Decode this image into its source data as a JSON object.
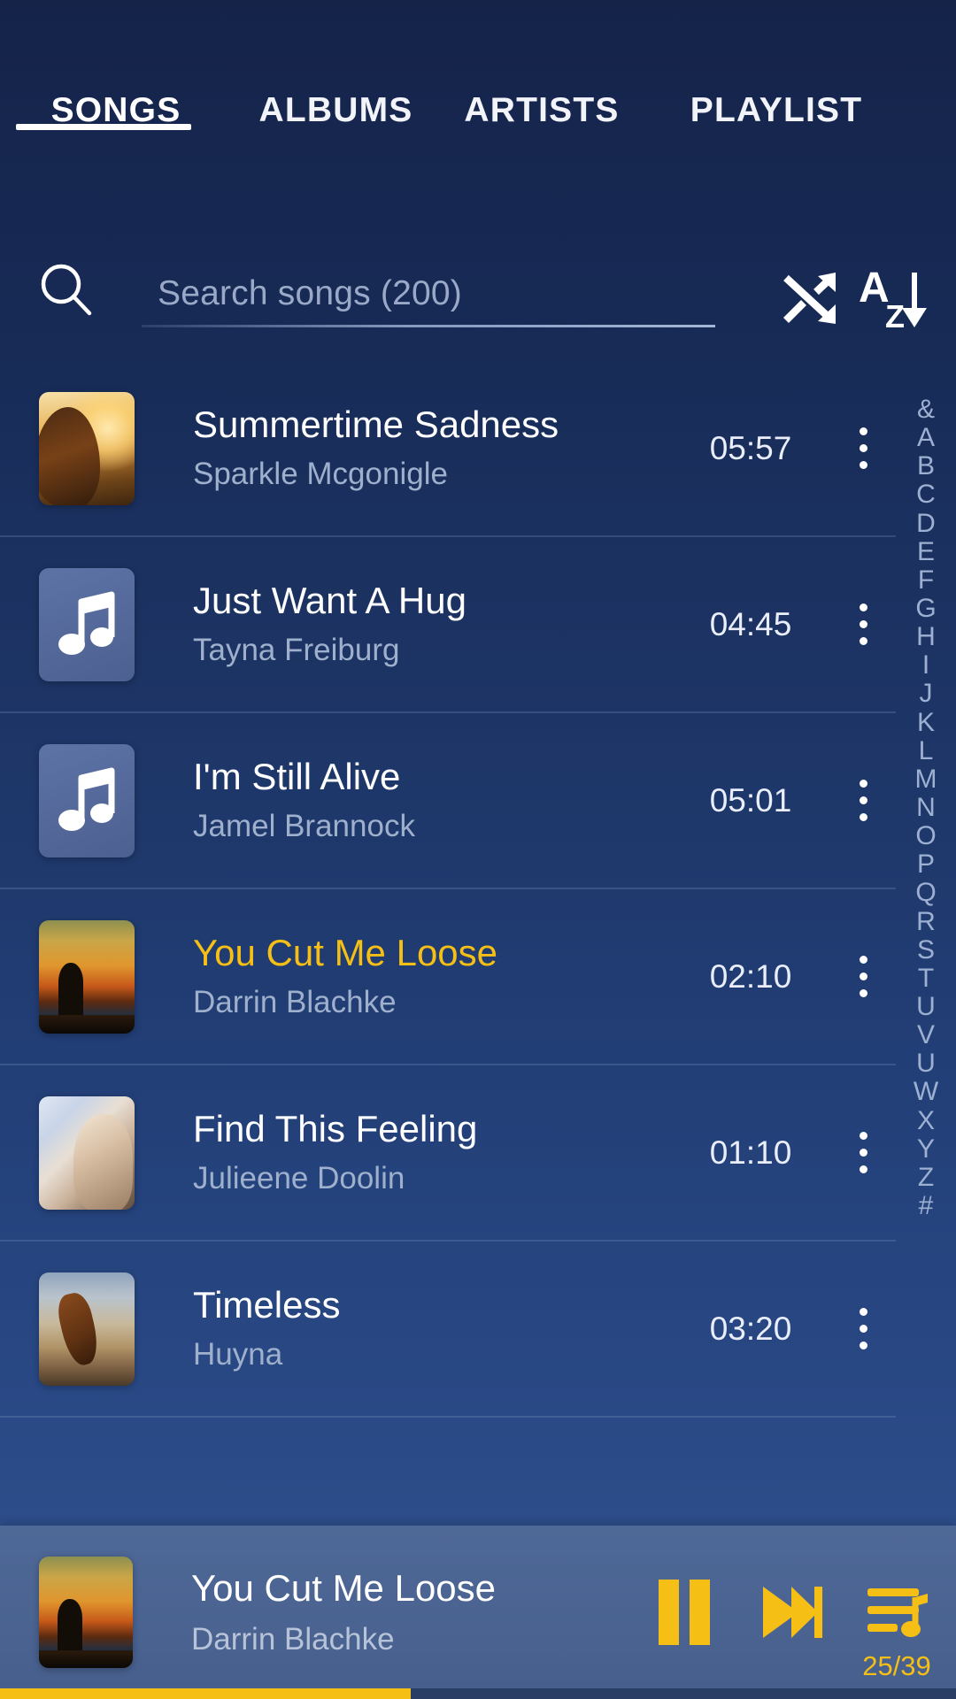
{
  "theme": {
    "bg_top": "#152349",
    "bg_bottom": "#33548f",
    "accent": "#f5bf15",
    "text_primary": "#ffffff",
    "text_secondary": "#9fb0cd",
    "nowbar_bg": "#4a6391"
  },
  "tabs": [
    {
      "label": "SONGS",
      "active": true
    },
    {
      "label": "ALBUMS",
      "active": false
    },
    {
      "label": "ARTISTS",
      "active": false
    },
    {
      "label": "PLAYLIST",
      "active": false
    }
  ],
  "search": {
    "placeholder": "Search songs (200)",
    "value": "",
    "icon": "search-icon",
    "shuffle_icon": "shuffle-icon",
    "sort_icon": "sort-alpha-ascending-icon",
    "sort_letter_top": "A",
    "sort_letter_bottom": "Z"
  },
  "songs": [
    {
      "title": "Summertime Sadness",
      "artist": "Sparkle Mcgonigle",
      "duration": "05:57",
      "art": "photo1",
      "playing": false
    },
    {
      "title": "Just Want A Hug",
      "artist": "Tayna Freiburg",
      "duration": "04:45",
      "art": "placeholder",
      "playing": false
    },
    {
      "title": "I'm Still Alive",
      "artist": "Jamel Brannock",
      "duration": "05:01",
      "art": "placeholder",
      "playing": false
    },
    {
      "title": "You Cut Me Loose",
      "artist": "Darrin Blachke",
      "duration": "02:10",
      "art": "photo2",
      "playing": true
    },
    {
      "title": "Find This Feeling",
      "artist": "Julieene Doolin",
      "duration": "01:10",
      "art": "photo3",
      "playing": false
    },
    {
      "title": "Timeless",
      "artist": "Huyna",
      "duration": "03:20",
      "art": "photo4",
      "playing": false
    }
  ],
  "alphabet_index": [
    "&",
    "A",
    "B",
    "C",
    "D",
    "E",
    "F",
    "G",
    "H",
    "I",
    "J",
    "K",
    "L",
    "M",
    "N",
    "O",
    "P",
    "Q",
    "R",
    "S",
    "T",
    "U",
    "V",
    "U",
    "W",
    "X",
    "Y",
    "Z",
    "#"
  ],
  "now_playing": {
    "title": "You Cut Me Loose",
    "artist": "Darrin Blachke",
    "art": "photo2",
    "pause_icon": "pause-icon",
    "next_icon": "next-track-icon",
    "queue_icon": "queue-list-icon",
    "counter": "25/39",
    "progress_percent": 43
  }
}
